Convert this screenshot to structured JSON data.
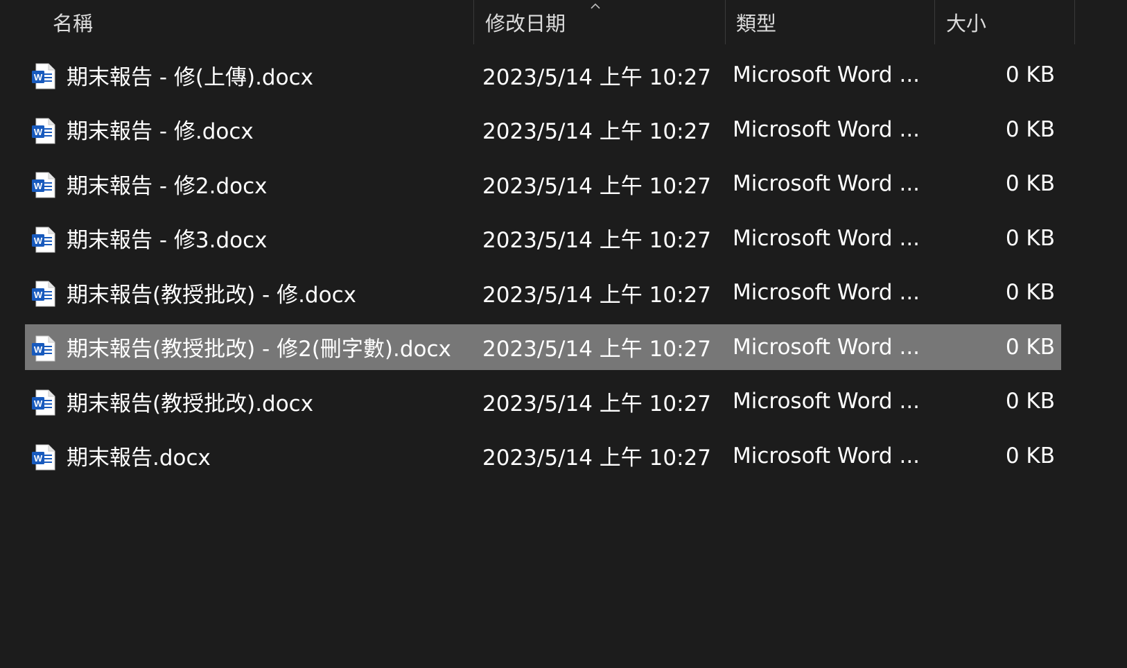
{
  "columns": {
    "name": "名稱",
    "date": "修改日期",
    "type": "類型",
    "size": "大小"
  },
  "sort_icon": "chevron-up-icon",
  "file_icon": "word-document-icon",
  "colors": {
    "background": "#1c1c1c",
    "selected_row": "#777777",
    "word_blue": "#185abd"
  },
  "files": [
    {
      "name": "期末報告 - 修(上傳).docx",
      "date": "2023/5/14 上午 10:27",
      "type": "Microsoft Word ...",
      "size": "0 KB",
      "selected": false
    },
    {
      "name": "期末報告 - 修.docx",
      "date": "2023/5/14 上午 10:27",
      "type": "Microsoft Word ...",
      "size": "0 KB",
      "selected": false
    },
    {
      "name": "期末報告 - 修2.docx",
      "date": "2023/5/14 上午 10:27",
      "type": "Microsoft Word ...",
      "size": "0 KB",
      "selected": false
    },
    {
      "name": "期末報告 - 修3.docx",
      "date": "2023/5/14 上午 10:27",
      "type": "Microsoft Word ...",
      "size": "0 KB",
      "selected": false
    },
    {
      "name": "期末報告(教授批改) - 修.docx",
      "date": "2023/5/14 上午 10:27",
      "type": "Microsoft Word ...",
      "size": "0 KB",
      "selected": false
    },
    {
      "name": "期末報告(教授批改) - 修2(刪字數).docx",
      "date": "2023/5/14 上午 10:27",
      "type": "Microsoft Word ...",
      "size": "0 KB",
      "selected": true
    },
    {
      "name": "期末報告(教授批改).docx",
      "date": "2023/5/14 上午 10:27",
      "type": "Microsoft Word ...",
      "size": "0 KB",
      "selected": false
    },
    {
      "name": "期末報告.docx",
      "date": "2023/5/14 上午 10:27",
      "type": "Microsoft Word ...",
      "size": "0 KB",
      "selected": false
    }
  ]
}
